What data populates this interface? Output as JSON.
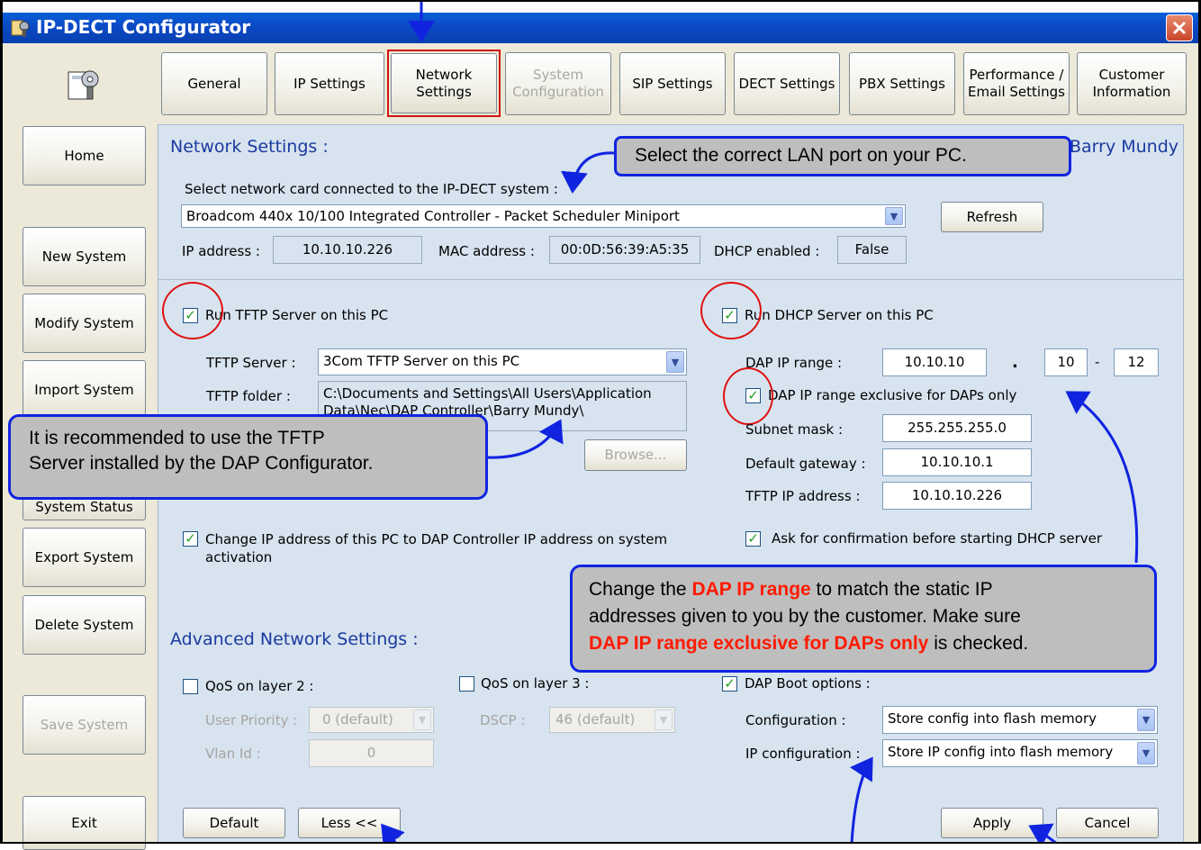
{
  "window": {
    "title": "IP-DECT Configurator"
  },
  "tabs": [
    {
      "label": "General",
      "disabled": false
    },
    {
      "label": "IP Settings",
      "disabled": false
    },
    {
      "label": "Network Settings",
      "disabled": false,
      "active": true
    },
    {
      "label": "System Configuration",
      "disabled": true
    },
    {
      "label": "SIP Settings",
      "disabled": false
    },
    {
      "label": "DECT Settings",
      "disabled": false
    },
    {
      "label": "PBX Settings",
      "disabled": false
    },
    {
      "label": "Performance / Email Settings",
      "disabled": false
    },
    {
      "label": "Customer Information",
      "disabled": false
    }
  ],
  "sidebar": {
    "home": "Home",
    "new_system": "New System",
    "modify_system": "Modify System",
    "import_system": "Import System",
    "system_status": "System Status",
    "export_system": "Export System",
    "delete_system": "Delete System",
    "save_system": "Save System",
    "exit": "Exit"
  },
  "network": {
    "section_title": "Network Settings :",
    "user_name": "Barry Mundy",
    "select_card_label": "Select network card connected to the IP-DECT system :",
    "card_value": "Broadcom 440x 10/100 Integrated Controller - Packet Scheduler Miniport",
    "refresh_label": "Refresh",
    "ip_label": "IP address :",
    "ip_value": "10.10.10.226",
    "mac_label": "MAC address :",
    "mac_value": "00:0D:56:39:A5:35",
    "dhcp_enabled_label": "DHCP enabled :",
    "dhcp_enabled_value": "False"
  },
  "tftp": {
    "run_label": "Run TFTP Server on this PC",
    "run_checked": true,
    "server_label": "TFTP Server :",
    "server_value": "3Com TFTP Server on this PC",
    "folder_label": "TFTP folder :",
    "folder_value_line1": "C:\\Documents and Settings\\All Users\\Application",
    "folder_value_line2": "Data\\Nec\\DAP Controller\\Barry Mundy\\",
    "browse_label": "Browse...",
    "change_ip_label_line1": "Change IP address of this PC to DAP Controller IP address on system",
    "change_ip_label_line2": "activation",
    "change_ip_checked": true
  },
  "dhcp": {
    "run_label": "Run DHCP Server on this PC",
    "run_checked": true,
    "range_label": "DAP IP range :",
    "range_prefix": "10.10.10",
    "range_dot": ".",
    "range_start": "10",
    "range_dash": "-",
    "range_end": "12",
    "exclusive_label": "DAP IP range exclusive for DAPs only",
    "exclusive_checked": true,
    "subnet_label": "Subnet mask :",
    "subnet_value": "255.255.255.0",
    "gateway_label": "Default gateway :",
    "gateway_value": "10.10.10.1",
    "tftp_ip_label": "TFTP IP address :",
    "tftp_ip_value": "10.10.10.226",
    "confirm_label": "Ask for confirmation before starting DHCP server",
    "confirm_checked": true
  },
  "advanced": {
    "section_title": "Advanced Network Settings :",
    "qos2_label": "QoS on layer 2 :",
    "qos2_checked": false,
    "user_priority_label": "User Priority :",
    "user_priority_value": "0 (default)",
    "vlan_label": "Vlan Id :",
    "vlan_value": "0",
    "qos3_label": "QoS on layer 3 :",
    "qos3_checked": false,
    "dscp_label": "DSCP :",
    "dscp_value": "46 (default)",
    "boot_label": "DAP Boot options :",
    "boot_checked": true,
    "config_label": "Configuration :",
    "config_value": "Store config into flash memory",
    "ipconfig_label": "IP configuration :",
    "ipconfig_value": "Store IP config into flash memory"
  },
  "footer": {
    "default_label": "Default",
    "less_label": "Less <<",
    "apply_label": "Apply",
    "cancel_label": "Cancel"
  },
  "callouts": {
    "lan_port": "Select the correct LAN port on your PC.",
    "tftp_line1": "It is recommended to use the TFTP",
    "tftp_line2": "Server installed by the DAP Configurator.",
    "range_pre": "Change the ",
    "range_red1": "DAP IP range",
    "range_mid": " to match the static IP",
    "range_line2": "addresses given to you by the customer. Make sure",
    "range_red2": "DAP IP range exclusive for DAPs only",
    "range_post": " is checked."
  },
  "colors": {
    "annotation_blue": "#1024e0",
    "annotation_red": "#e01010",
    "titlebar": "#0b49c5"
  },
  "icons": {
    "app": "gear-tool-icon",
    "close": "close-icon"
  }
}
